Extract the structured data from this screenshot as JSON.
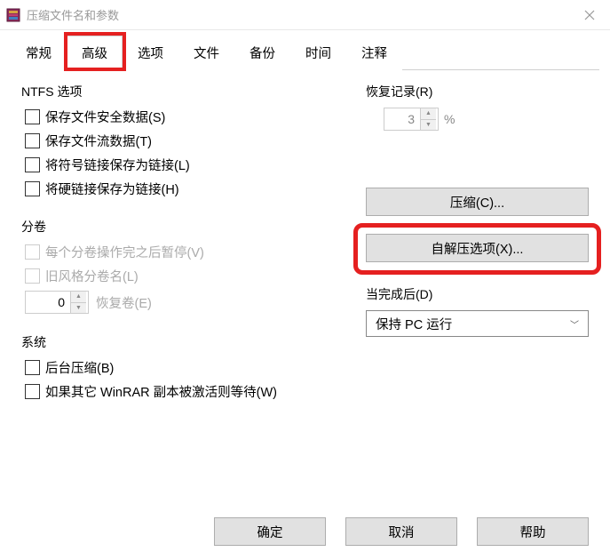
{
  "titlebar": {
    "title": "压缩文件名和参数"
  },
  "tabs": {
    "items": [
      {
        "label": "常规"
      },
      {
        "label": "高级"
      },
      {
        "label": "选项"
      },
      {
        "label": "文件"
      },
      {
        "label": "备份"
      },
      {
        "label": "时间"
      },
      {
        "label": "注释"
      }
    ]
  },
  "ntfs": {
    "legend": "NTFS 选项",
    "save_security": "保存文件安全数据(S)",
    "save_streams": "保存文件流数据(T)",
    "store_symlinks": "将符号链接保存为链接(L)",
    "store_hardlinks": "将硬链接保存为链接(H)"
  },
  "volumes": {
    "legend": "分卷",
    "pause_after": "每个分卷操作完之后暂停(V)",
    "old_style": "旧风格分卷名(L)",
    "recovery_value": "0",
    "recovery_label": "恢复卷(E)"
  },
  "system": {
    "legend": "系统",
    "background": "后台压缩(B)",
    "wait_other": "如果其它 WinRAR 副本被激活则等待(W)"
  },
  "recovery": {
    "legend": "恢复记录(R)",
    "value": "3",
    "unit": "%"
  },
  "buttons": {
    "compression": "压缩(C)...",
    "sfx": "自解压选项(X)..."
  },
  "when_done": {
    "legend": "当完成后(D)",
    "value": "保持 PC 运行"
  },
  "dialog": {
    "ok": "确定",
    "cancel": "取消",
    "help": "帮助"
  }
}
